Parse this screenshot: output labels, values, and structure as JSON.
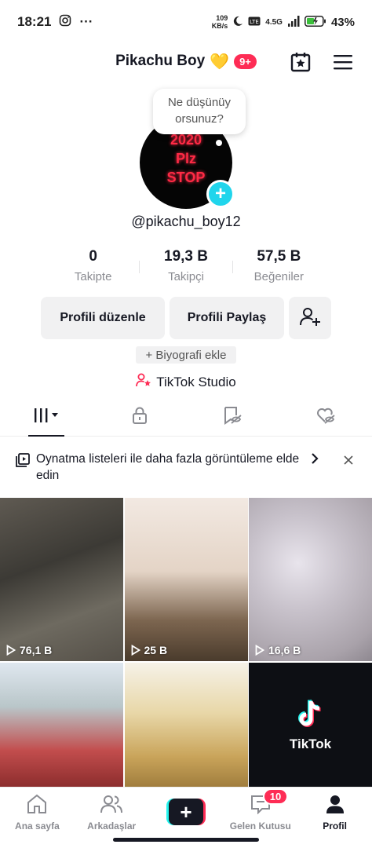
{
  "status_bar": {
    "time": "18:21",
    "dots": "···",
    "net_speed_value": "109",
    "net_speed_unit": "KB/s",
    "network": "4.5G",
    "battery_pct": "43%"
  },
  "header": {
    "title": "Pikachu Boy",
    "heart": "💛",
    "badge": "9+"
  },
  "profile": {
    "avatar_text_1": "2020",
    "avatar_text_2": "Plz",
    "avatar_text_3": "STOP",
    "thought_line1": "Ne düşünüy",
    "thought_line2": "orsunuz?",
    "handle": "@pikachu_boy12"
  },
  "stats": [
    {
      "value": "0",
      "label": "Takipte"
    },
    {
      "value": "19,3 B",
      "label": "Takipçi"
    },
    {
      "value": "57,5 B",
      "label": "Beğeniler"
    }
  ],
  "buttons": {
    "edit": "Profili düzenle",
    "share": "Profili Paylaş"
  },
  "bio_add": "+ Biyografi ekle",
  "studio": "TikTok Studio",
  "banner": {
    "text": "Oynatma listeleri ile daha fazla görüntüleme elde edin"
  },
  "videos": [
    {
      "views": "76,1 B"
    },
    {
      "views": "25 B"
    },
    {
      "views": "16,6 B"
    },
    {
      "views": ""
    },
    {
      "views": ""
    },
    {
      "views": ""
    }
  ],
  "tiktok_tile_label": "TikTok",
  "nav": {
    "home": "Ana sayfa",
    "friends": "Arkadaşlar",
    "inbox": "Gelen Kutusu",
    "inbox_badge": "10",
    "profile": "Profil"
  },
  "colors": {
    "accent": "#fe2c55",
    "cyan": "#25f4ee",
    "text": "#161823",
    "muted": "#8a8b91"
  }
}
